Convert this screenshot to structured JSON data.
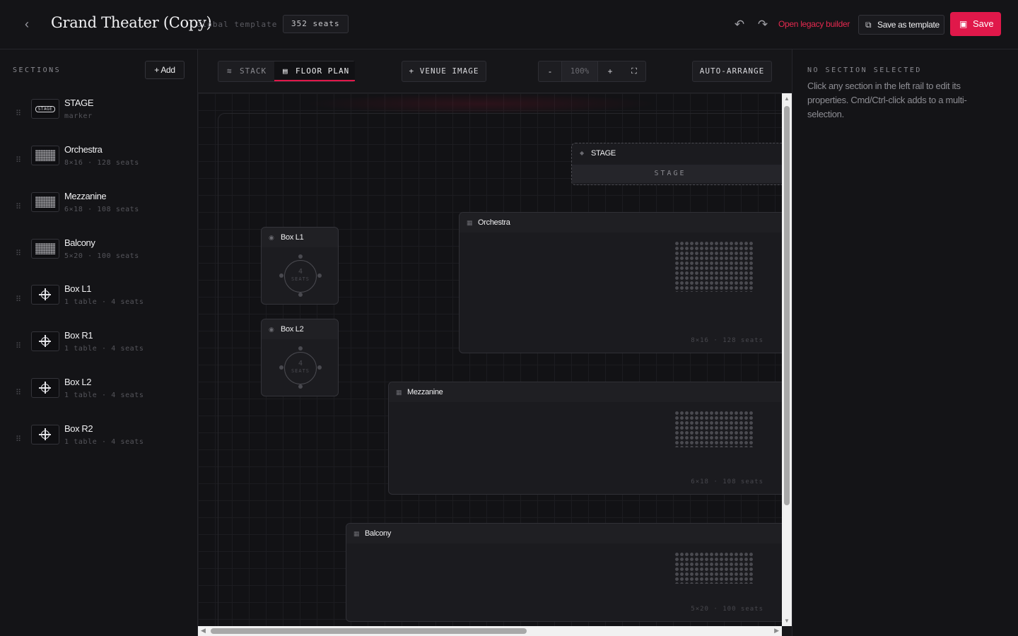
{
  "header": {
    "back_icon": "chevron-left-icon",
    "title": "Grand Theater (Copy)",
    "template_label": "Global template",
    "seat_count": "352 seats",
    "undo_icon": "undo-icon",
    "redo_icon": "redo-icon",
    "legacy_link": "Open legacy builder",
    "save_template_label": "Save as template",
    "save_label": "Save",
    "accent_color": "#e0184a"
  },
  "sidebar": {
    "title": "SECTIONS",
    "add_label": "Add",
    "items": [
      {
        "name": "STAGE",
        "meta": "marker",
        "thumb": "STAGE",
        "icon": "stage-marker-icon"
      },
      {
        "name": "Orchestra",
        "meta": "8×16 · 128 seats",
        "icon": "seat-grid-icon"
      },
      {
        "name": "Mezzanine",
        "meta": "6×18 · 108 seats",
        "icon": "seat-grid-icon"
      },
      {
        "name": "Balcony",
        "meta": "5×20 · 100 seats",
        "icon": "seat-grid-icon"
      },
      {
        "name": "Box L1",
        "meta": "1 table · 4 seats",
        "icon": "table-icon"
      },
      {
        "name": "Box R1",
        "meta": "1 table · 4 seats",
        "icon": "table-icon"
      },
      {
        "name": "Box L2",
        "meta": "1 table · 4 seats",
        "icon": "table-icon"
      },
      {
        "name": "Box R2",
        "meta": "1 table · 4 seats",
        "icon": "table-icon"
      }
    ]
  },
  "toolbar": {
    "stack_label": "STACK",
    "floor_plan_label": "FLOOR PLAN",
    "venue_image_label": "+ VENUE IMAGE",
    "zoom_out": "-",
    "zoom_value": "100%",
    "zoom_in": "+",
    "fullscreen_icon": "fullscreen-icon",
    "auto_arrange_label": "AUTO-ARRANGE"
  },
  "canvas": {
    "stage": {
      "title": "STAGE",
      "bar_text": "STAGE"
    },
    "sections": [
      {
        "title": "Orchestra",
        "footer": "8×16 · 128 seats"
      },
      {
        "title": "Mezzanine",
        "footer": "6×18 · 108 seats"
      },
      {
        "title": "Balcony",
        "footer": "5×20 · 100 seats"
      }
    ],
    "boxes": [
      {
        "title": "Box L1",
        "seats": "4",
        "seats_label": "SEATS"
      },
      {
        "title": "Box L2",
        "seats": "4",
        "seats_label": "SEATS"
      }
    ]
  },
  "right_panel": {
    "title": "NO SECTION SELECTED",
    "body": "Click any section in the left rail to edit its properties. Cmd/Ctrl-click adds to a multi-selection."
  }
}
